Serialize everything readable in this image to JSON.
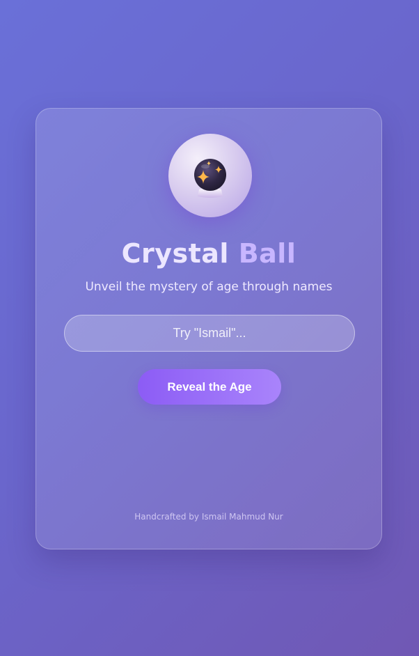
{
  "header": {
    "title_part1": "Crystal",
    "title_part2": "Ball",
    "subtitle": "Unveil the mystery of age through names"
  },
  "form": {
    "name_placeholder": "Try \"Ismail\"...",
    "name_value": "",
    "submit_label": "Reveal the Age"
  },
  "footer": {
    "credit": "Handcrafted by Ismail Mahmud Nur"
  },
  "icons": {
    "hero": "crystal-ball-icon"
  },
  "colors": {
    "accent_start": "#8c5cf5",
    "accent_end": "#a984fb",
    "title": "#ece6ff",
    "title_accent": "#c8b6ff"
  }
}
